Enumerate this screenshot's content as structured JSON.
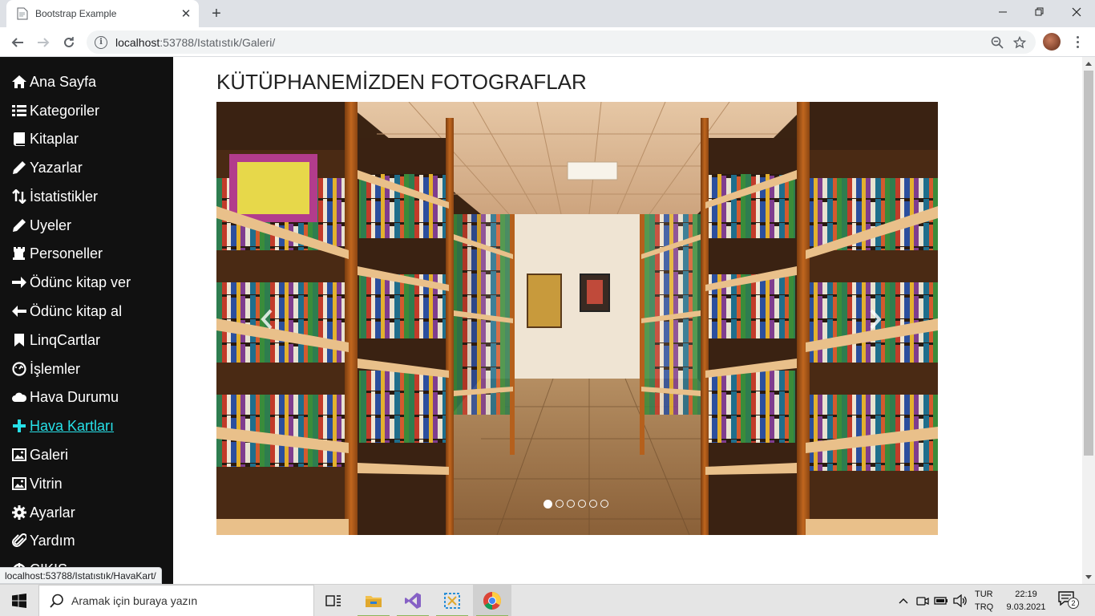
{
  "browser": {
    "tab_title": "Bootstrap Example",
    "url_host": "localhost",
    "url_path": ":53788/Istatıstık/Galeri/",
    "status_url": "localhost:53788/Istatıstık/HavaKart/"
  },
  "sidebar": {
    "items": [
      {
        "label": "Ana Sayfa",
        "icon": "home-icon"
      },
      {
        "label": "Kategoriler",
        "icon": "list-icon"
      },
      {
        "label": "Kitaplar",
        "icon": "book-icon"
      },
      {
        "label": "Yazarlar",
        "icon": "pencil-icon"
      },
      {
        "label": "İstatistikler",
        "icon": "sort-icon"
      },
      {
        "label": "Uyeler",
        "icon": "pencil-icon"
      },
      {
        "label": "Personeller",
        "icon": "tower-icon"
      },
      {
        "label": "Ödünc kitap ver",
        "icon": "arrow-right-icon"
      },
      {
        "label": "Ödünc kitap al",
        "icon": "arrow-left-icon"
      },
      {
        "label": "LinqCartlar",
        "icon": "bookmark-icon"
      },
      {
        "label": "İşlemler",
        "icon": "dashboard-icon"
      },
      {
        "label": "Hava Durumu",
        "icon": "cloud-icon"
      },
      {
        "label": " Hava Kartları",
        "icon": "plus-icon"
      },
      {
        "label": "Galeri",
        "icon": "picture-icon"
      },
      {
        "label": "Vitrin",
        "icon": "picture-icon"
      },
      {
        "label": "Ayarlar",
        "icon": "cog-icon"
      },
      {
        "label": "Yardım",
        "icon": "paperclip-icon"
      },
      {
        "label": "ÇIKIŞ",
        "icon": "off-icon"
      }
    ],
    "active_index": 12,
    "active_color": "#27e0e8"
  },
  "main": {
    "title": "KÜTÜPHANEMİZDEN FOTOGRAFLAR",
    "carousel": {
      "slide_count": 6,
      "active_slide": 1
    }
  },
  "taskbar": {
    "search_placeholder": "Aramak için buraya yazın",
    "lang_top": "TUR",
    "lang_bottom": "TRQ",
    "time": "22:19",
    "date": "9.03.2021",
    "notification_count": "2"
  }
}
